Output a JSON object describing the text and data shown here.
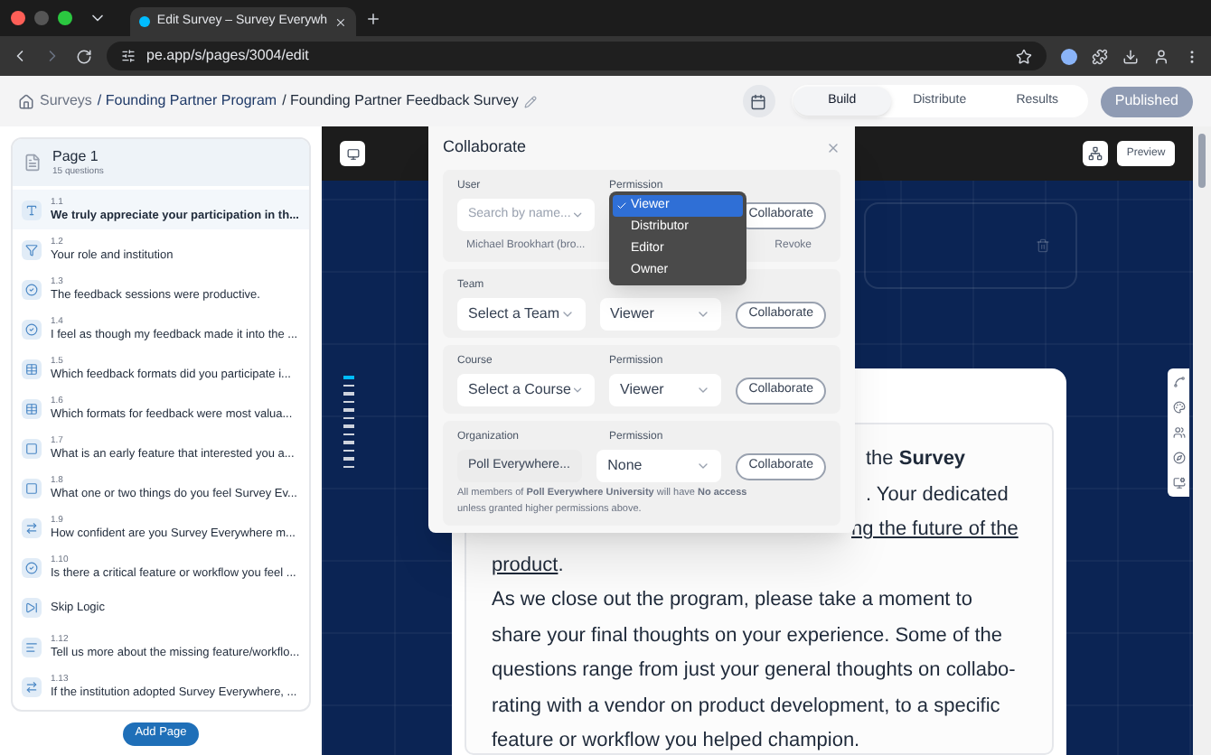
{
  "browser": {
    "tab_title": "Edit Survey – Survey Everywh",
    "url": "pe.app/s/pages/3004/edit"
  },
  "header": {
    "breadcrumbs": [
      {
        "label": "Surveys",
        "kind": "home"
      },
      {
        "label": "/ Founding Partner Program",
        "kind": "link"
      },
      {
        "label": "/ Founding Partner Feedback Survey",
        "kind": "current"
      }
    ],
    "tabs": [
      {
        "label": "Build",
        "selected": true
      },
      {
        "label": "Distribute",
        "selected": false
      },
      {
        "label": "Results",
        "selected": false
      }
    ],
    "publish_button": "Published"
  },
  "sidebar": {
    "page": {
      "title": "Page 1",
      "subtitle": "15 questions"
    },
    "items": [
      {
        "number": "1.1",
        "text": "We truly appreciate your participation in th...",
        "kind": "text",
        "selected": true
      },
      {
        "number": "1.2",
        "text": "Your role and institution",
        "kind": "filter",
        "selected": false
      },
      {
        "number": "1.3",
        "text": "The feedback sessions were productive.",
        "kind": "rating",
        "selected": false
      },
      {
        "number": "1.4",
        "text": "I feel as though my feedback made it into the ...",
        "kind": "rating",
        "selected": false
      },
      {
        "number": "1.5",
        "text": "Which feedback formats did you participate i...",
        "kind": "grid",
        "selected": false
      },
      {
        "number": "1.6",
        "text": "Which formats for feedback were most valua...",
        "kind": "grid",
        "selected": false
      },
      {
        "number": "1.7",
        "text": "What is an early feature that interested you a...",
        "kind": "open",
        "selected": false
      },
      {
        "number": "1.8",
        "text": "What one or two things do you feel Survey Ev...",
        "kind": "open",
        "selected": false
      },
      {
        "number": "1.9",
        "text": "How confident are you Survey Everywhere m...",
        "kind": "scale",
        "selected": false
      },
      {
        "number": "1.10",
        "text": "Is there a critical feature or workflow you feel ...",
        "kind": "rating",
        "selected": false
      },
      {
        "text": "Skip Logic",
        "kind": "skip",
        "selected": false
      },
      {
        "number": "1.12",
        "text": "Tell us more about the missing feature/workflo...",
        "kind": "short",
        "selected": false
      },
      {
        "number": "1.13",
        "text": "If the institution adopted Survey Everywhere, ...",
        "kind": "scale",
        "selected": false
      }
    ],
    "add_button": "Add Page"
  },
  "canvas": {
    "preview_button": "Preview",
    "card_lines": [
      [
        {
          "text": "the **Survey**",
          "underline": false
        }
      ],
      [
        {
          "text": ". Your dedicated",
          "underline": false
        }
      ],
      [
        {
          "text": "ng the future of the",
          "underline": true
        }
      ],
      [
        {
          "text": "product",
          "underline": true
        },
        {
          "text": ".",
          "underline": false
        }
      ],
      [
        {
          "text": "As we close out the program, please take a moment to",
          "underline": false
        }
      ],
      [
        {
          "text": "share your final thoughts on your experience. Some of the",
          "underline": false
        }
      ],
      [
        {
          "text": "questions range from just your general thoughts on collabo-",
          "underline": false
        }
      ],
      [
        {
          "text": "rating with a vendor on product development, to a specific",
          "underline": false
        }
      ],
      [
        {
          "text": "feature or workflow you helped champion.",
          "underline": false
        }
      ]
    ]
  },
  "modal": {
    "title": "Collaborate",
    "sections": [
      {
        "kind": "user",
        "label": "User",
        "permission_label": "Permission",
        "placeholder": "Search by name...",
        "button": "Collaborate",
        "member": "Michael Brookhart (bro...",
        "member_action": "Revoke",
        "menu": [
          {
            "label": "Viewer",
            "selected": true
          },
          {
            "label": "Distributor",
            "selected": false
          },
          {
            "label": "Editor",
            "selected": false
          },
          {
            "label": "Owner",
            "selected": false
          }
        ]
      },
      {
        "kind": "select",
        "label": "Team",
        "value": "Select a Team",
        "permission": "Viewer",
        "button": "Collaborate"
      },
      {
        "kind": "select",
        "label": "Course",
        "permission_label": "Permission",
        "value": "Select a Course",
        "permission": "Viewer",
        "button": "Collaborate"
      },
      {
        "kind": "org",
        "label": "Organization",
        "permission_label": "Permission",
        "value": "Poll Everywhere...",
        "permission": "None",
        "button": "Collaborate",
        "note": "All members of **Poll Everywhere University** will have **No access** unless granted higher permissions above."
      }
    ]
  }
}
